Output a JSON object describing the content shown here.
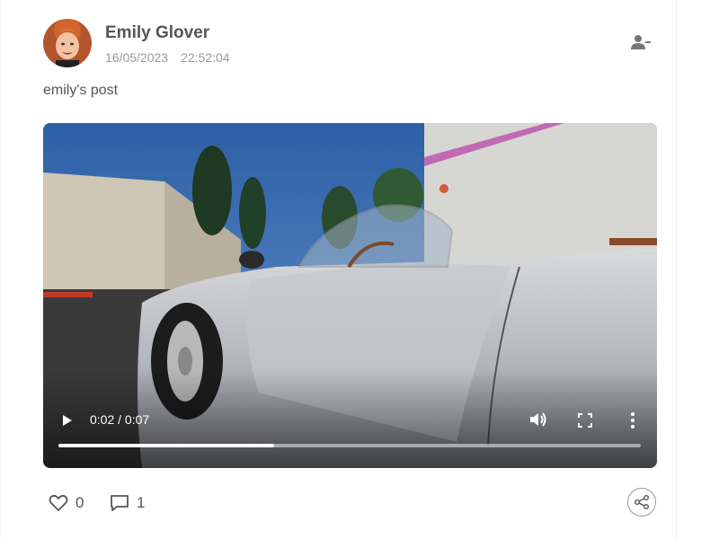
{
  "post": {
    "author": "Emily Glover",
    "date": "16/05/2023",
    "time": "22:52:04",
    "text": "emily's post"
  },
  "video": {
    "current_time": "0:02",
    "duration": "0:07",
    "time_display": "0:02 / 0:07",
    "progress_fraction": 0.37
  },
  "actions": {
    "likes": "0",
    "comments": "1"
  },
  "icons": {
    "follow": "user-minus-icon",
    "play": "play-icon",
    "volume": "volume-icon",
    "fullscreen": "fullscreen-icon",
    "more": "more-vertical-icon",
    "like": "heart-icon",
    "comment": "comment-icon",
    "share": "share-icon"
  },
  "colors": {
    "text": "#555555",
    "meta": "#9a9a9a",
    "video_bg": "#111111"
  }
}
